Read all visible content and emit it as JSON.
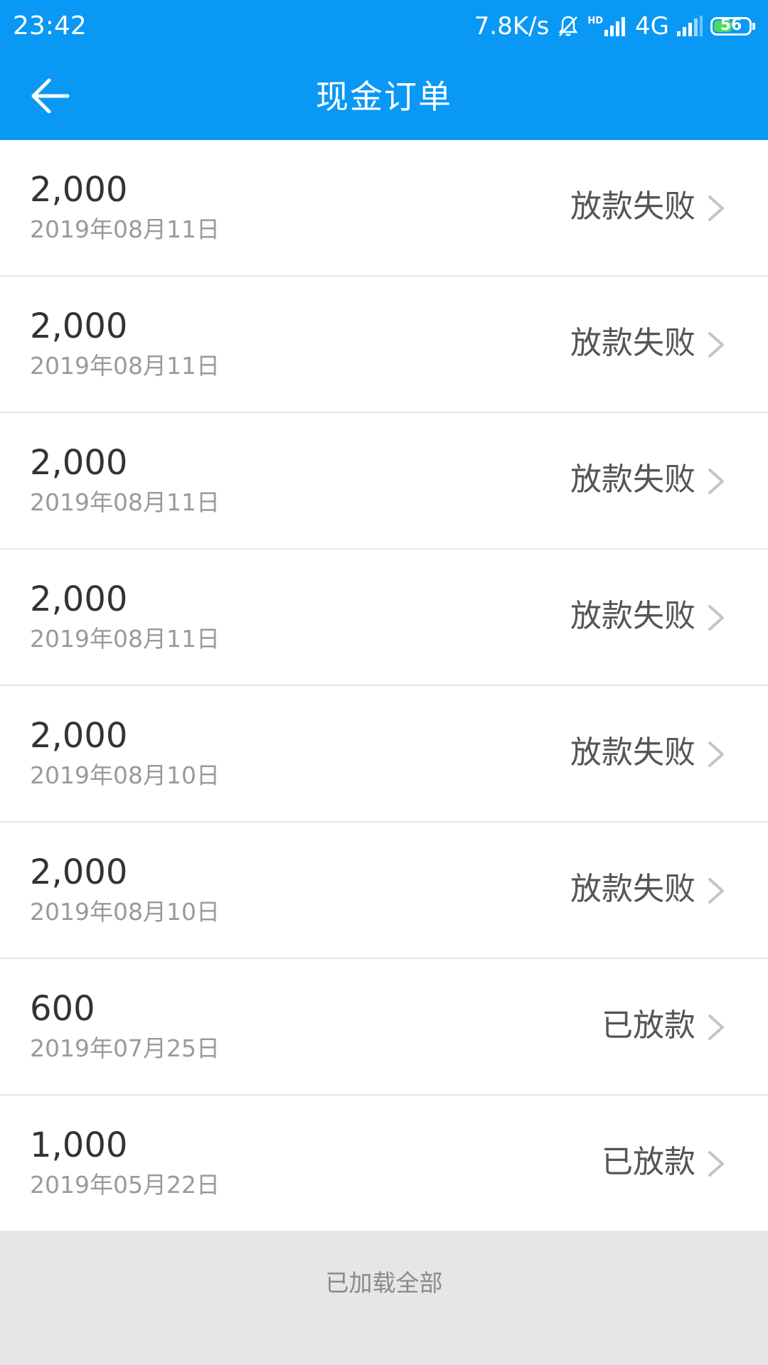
{
  "status_bar": {
    "time": "23:42",
    "network_speed": "7.8K/s",
    "hd_label": "HD",
    "network_type": "4G",
    "battery_level": "56",
    "battery_fraction": 0.56,
    "battery_color": "#4cd964"
  },
  "header": {
    "title": "现金订单",
    "back_icon": "arrow-left-icon",
    "background_color": "#0a98f5"
  },
  "orders": [
    {
      "amount": "2,000",
      "date": "2019年08月11日",
      "status": "放款失败"
    },
    {
      "amount": "2,000",
      "date": "2019年08月11日",
      "status": "放款失败"
    },
    {
      "amount": "2,000",
      "date": "2019年08月11日",
      "status": "放款失败"
    },
    {
      "amount": "2,000",
      "date": "2019年08月11日",
      "status": "放款失败"
    },
    {
      "amount": "2,000",
      "date": "2019年08月10日",
      "status": "放款失败"
    },
    {
      "amount": "2,000",
      "date": "2019年08月10日",
      "status": "放款失败"
    },
    {
      "amount": "600",
      "date": "2019年07月25日",
      "status": "已放款"
    },
    {
      "amount": "1,000",
      "date": "2019年05月22日",
      "status": "已放款"
    }
  ],
  "footer": {
    "text": "已加载全部"
  }
}
